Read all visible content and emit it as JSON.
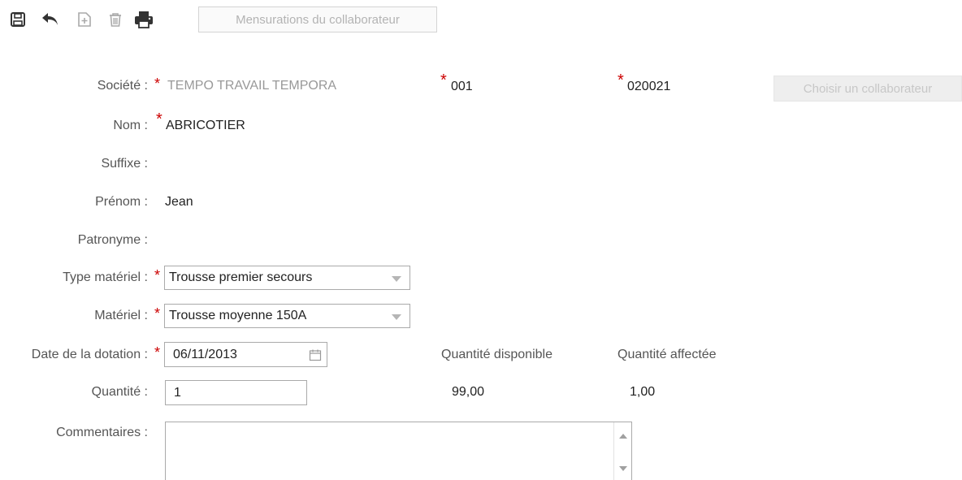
{
  "toolbar": {
    "icons": [
      "save-icon",
      "undo-icon",
      "new-document-icon",
      "delete-icon",
      "print-icon"
    ],
    "tab_label": "Mensurations du collaborateur"
  },
  "form": {
    "societe": {
      "label": "Société :",
      "required_mark": "*",
      "value": "TEMPO TRAVAIL TEMPORA",
      "code1": "001",
      "code2": "020021",
      "choose_button": "Choisir un collaborateur"
    },
    "nom": {
      "label": "Nom :",
      "value": "ABRICOTIER"
    },
    "suffixe": {
      "label": "Suffixe :",
      "value": ""
    },
    "prenom": {
      "label": "Prénom :",
      "value": "Jean"
    },
    "patronyme": {
      "label": "Patronyme :",
      "value": ""
    },
    "type_materiel": {
      "label": "Type matériel :",
      "selected": "Trousse premier secours"
    },
    "materiel": {
      "label": "Matériel :",
      "selected": "Trousse moyenne 150A"
    },
    "date_dotation": {
      "label": "Date de la dotation :",
      "value": "06/11/2013"
    },
    "quantite": {
      "label": "Quantité :",
      "value": "1"
    },
    "commentaires": {
      "label": "Commentaires :",
      "value": ""
    }
  },
  "stats": {
    "disponible_label": "Quantité disponible",
    "affectee_label": "Quantité affectée",
    "disponible_value": "99,00",
    "affectee_value": "1,00"
  },
  "colors": {
    "required": "#cc0000",
    "disabled_text": "#b3b3b3",
    "label_text": "#555555"
  }
}
